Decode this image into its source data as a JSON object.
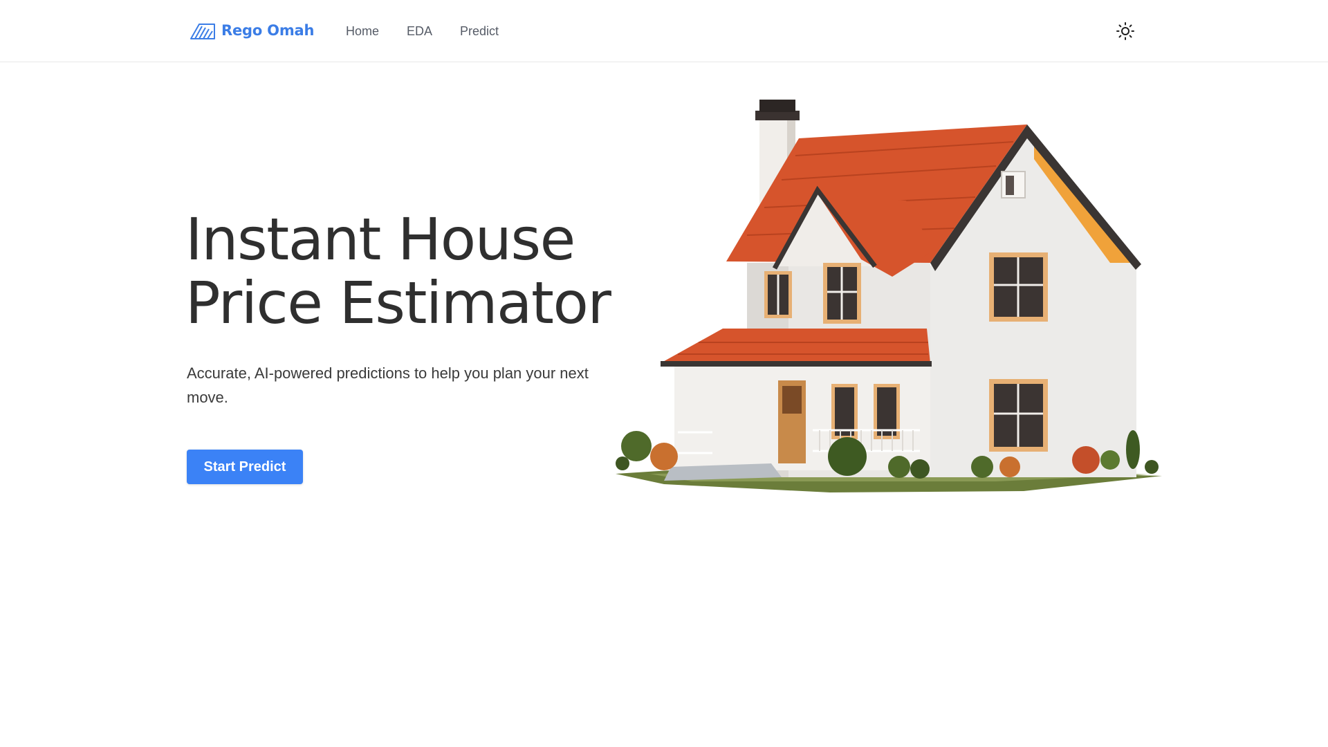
{
  "brand": {
    "name": "Rego Omah",
    "logo_icon": "roof-logo-icon",
    "color": "#3b7de6"
  },
  "nav": {
    "items": [
      {
        "label": "Home"
      },
      {
        "label": "EDA"
      },
      {
        "label": "Predict"
      }
    ]
  },
  "theme_toggle": {
    "icon": "sun-icon"
  },
  "hero": {
    "title_line1": "Instant House",
    "title_line2": "Price Estimator",
    "subtitle": "Accurate, AI-powered predictions to help you plan your next move.",
    "cta_label": "Start Predict",
    "cta_color": "#3b82f6",
    "image": "house-illustration"
  }
}
